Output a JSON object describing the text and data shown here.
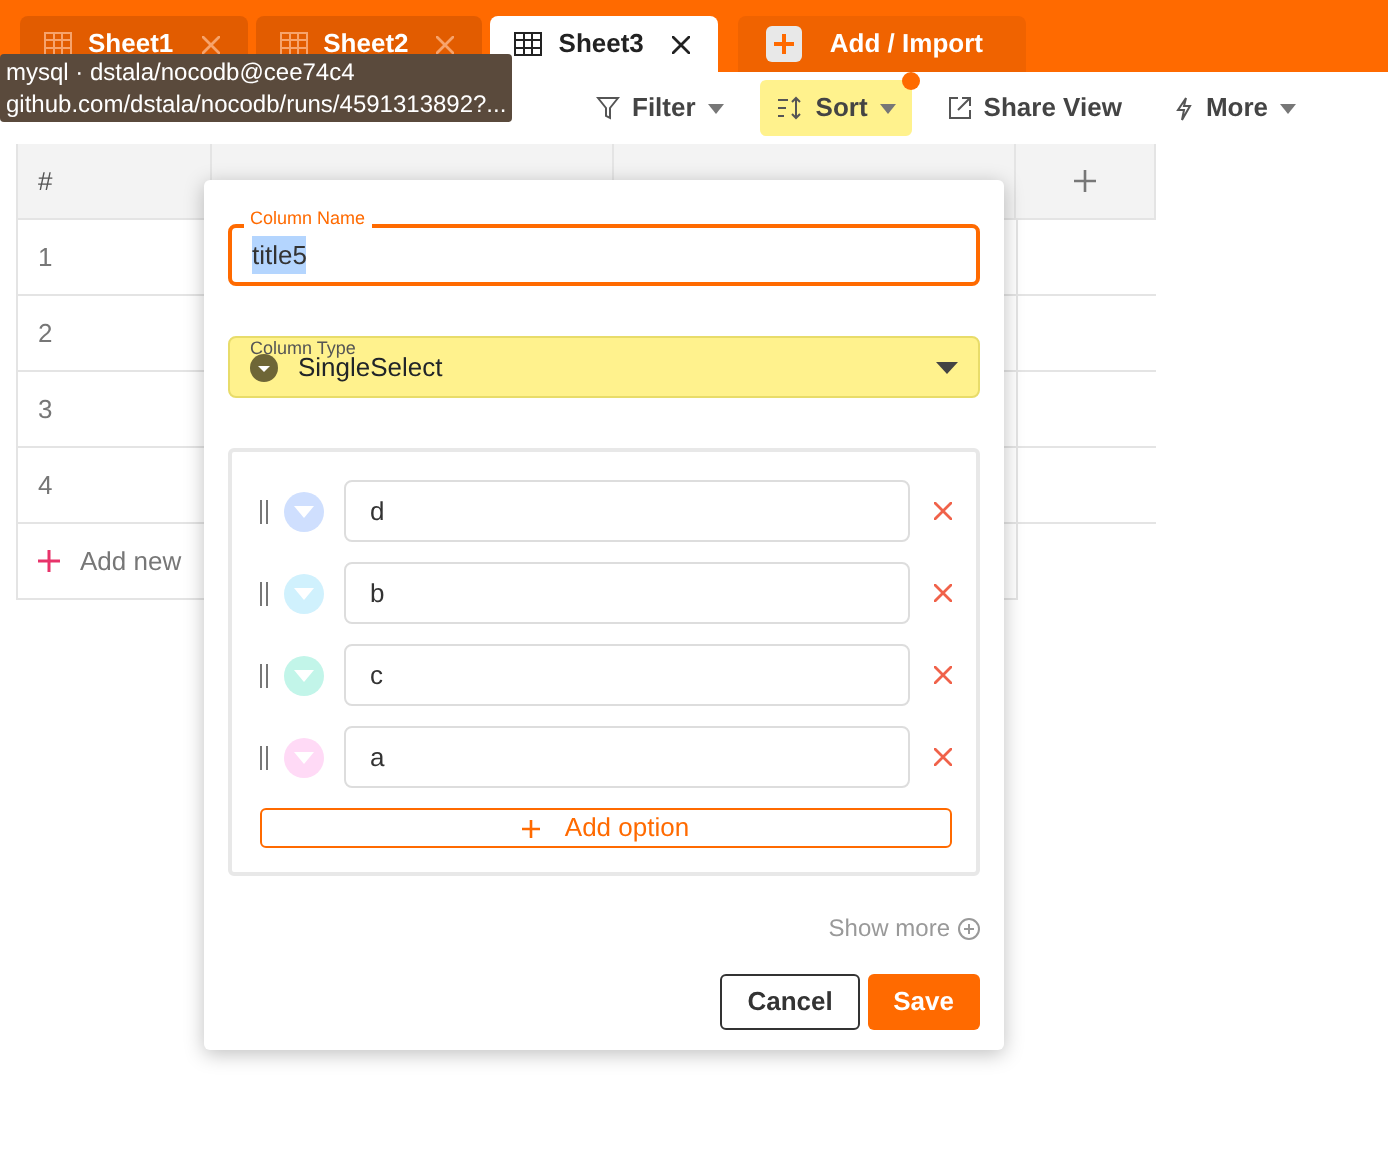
{
  "tabs": [
    {
      "label": "Sheet1",
      "selected": false
    },
    {
      "label": "Sheet2",
      "selected": false
    },
    {
      "label": "Sheet3",
      "selected": true
    }
  ],
  "add_import": "Add / Import",
  "tooltip": [
    "mysql · dstala/nocodb@cee74c4",
    "github.com/dstala/nocodb/runs/4591313892?..."
  ],
  "toolbar": [
    {
      "kind": "filter",
      "label": "Filter",
      "active": false
    },
    {
      "kind": "sort",
      "label": "Sort",
      "active": true
    },
    {
      "kind": "share",
      "label": "Share View",
      "active": false
    },
    {
      "kind": "more",
      "label": "More",
      "active": false
    }
  ],
  "grid": {
    "columns": [
      "#"
    ],
    "rows": [
      "1",
      "2",
      "3",
      "4"
    ],
    "add_row": "Add new"
  },
  "modal": {
    "column_name": {
      "label": "Column Name",
      "value": "title5"
    },
    "column_type": {
      "label": "Column Type",
      "value": "SingleSelect"
    },
    "options": [
      {
        "label": "d",
        "color": "#cfdffe"
      },
      {
        "label": "b",
        "color": "#d0f1fd"
      },
      {
        "label": "c",
        "color": "#c2f5e9"
      },
      {
        "label": "a",
        "color": "#ffdaf6"
      }
    ],
    "add_option": "Add option",
    "show_more": "Show more",
    "buttons": {
      "cancel": "Cancel",
      "save": "Save"
    }
  }
}
